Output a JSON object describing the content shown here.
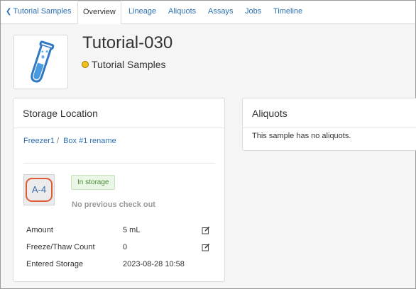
{
  "tabs": {
    "back_label": "Tutorial Samples",
    "items": [
      "Overview",
      "Lineage",
      "Aliquots",
      "Assays",
      "Jobs",
      "Timeline"
    ]
  },
  "sample": {
    "name": "Tutorial-030",
    "type": "Tutorial Samples",
    "status_color": "#f0c11a"
  },
  "storage": {
    "heading": "Storage Location",
    "breadcrumb": [
      "Freezer1",
      "Box #1 rename"
    ],
    "separator": "/",
    "cell": "A-4",
    "badge": "In storage",
    "checkout": "No previous check out",
    "rows": [
      {
        "label": "Amount",
        "value": "5 mL",
        "editable": true
      },
      {
        "label": "Freeze/Thaw Count",
        "value": "0",
        "editable": true
      },
      {
        "label": "Entered Storage",
        "value": "2023-08-28 10:58",
        "editable": false
      }
    ]
  },
  "aliquots": {
    "heading": "Aliquots",
    "message": "This sample has no aliquots."
  },
  "colors": {
    "link": "#2c70b2",
    "cell_highlight": "#e05a35",
    "badge_bg": "#eaf6e6"
  },
  "icons": [
    "chevron-left-icon",
    "test-tube-icon",
    "edit-icon"
  ]
}
